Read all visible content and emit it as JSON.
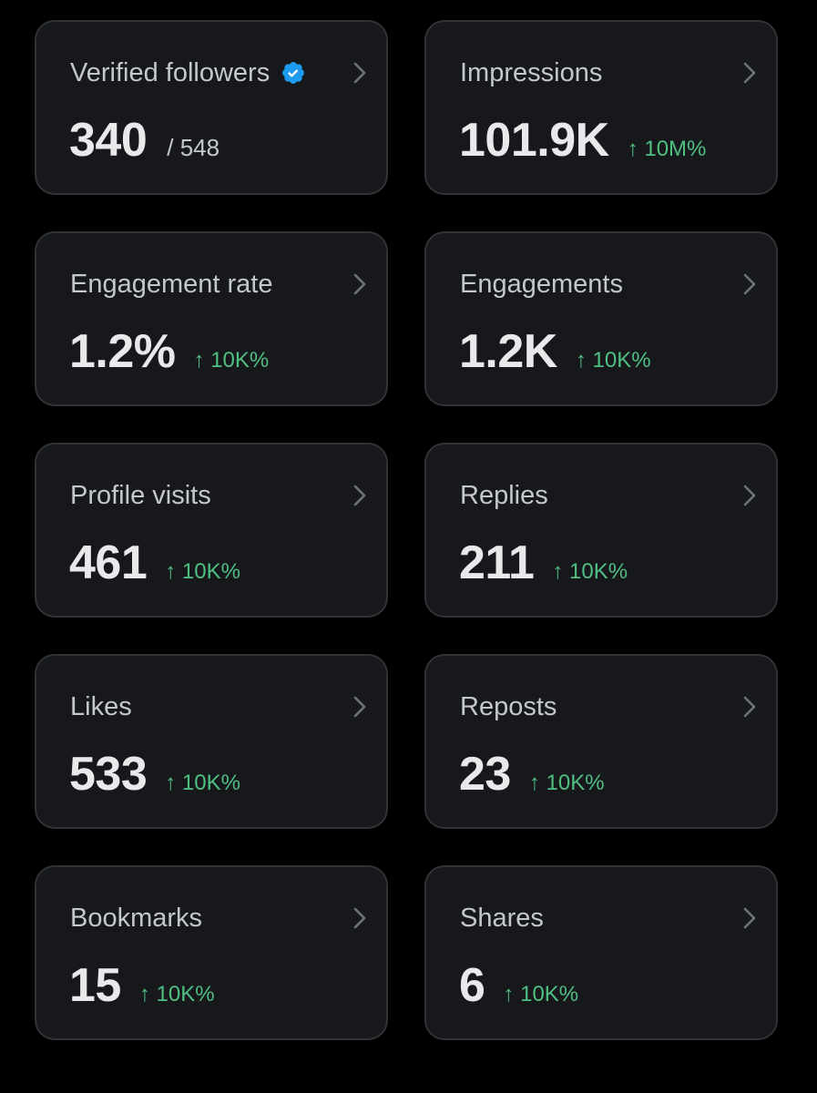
{
  "colors": {
    "background": "#000000",
    "card": "#17181c",
    "card_border": "#2f3336",
    "title_text": "#c4c7cb",
    "value_text": "#e7e9ea",
    "positive_change": "#4fbf82",
    "verified_badge": "#1d9bf0"
  },
  "icons": {
    "chevron": "chevron-right-icon",
    "verified": "verified-badge-icon"
  },
  "cards": [
    {
      "title": "Verified followers",
      "value": "340",
      "total": "/ 548"
    },
    {
      "title": "Impressions",
      "value": "101.9K",
      "change": "↑ 10M%"
    },
    {
      "title": "Engagement rate",
      "value": "1.2%",
      "change": "↑ 10K%"
    },
    {
      "title": "Engagements",
      "value": "1.2K",
      "change": "↑ 10K%"
    },
    {
      "title": "Profile visits",
      "value": "461",
      "change": "↑ 10K%"
    },
    {
      "title": "Replies",
      "value": "211",
      "change": "↑ 10K%"
    },
    {
      "title": "Likes",
      "value": "533",
      "change": "↑ 10K%"
    },
    {
      "title": "Reposts",
      "value": "23",
      "change": "↑ 10K%"
    },
    {
      "title": "Bookmarks",
      "value": "15",
      "change": "↑ 10K%"
    },
    {
      "title": "Shares",
      "value": "6",
      "change": "↑ 10K%"
    }
  ]
}
